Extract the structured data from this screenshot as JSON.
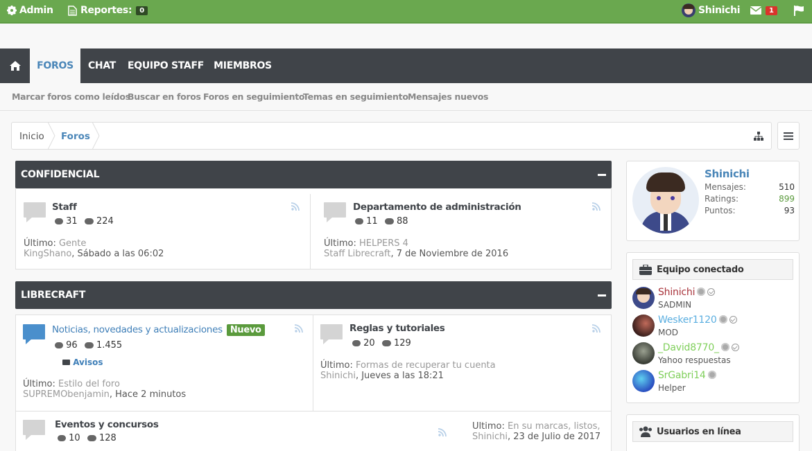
{
  "topbar": {
    "admin_label": "Admin",
    "reports_label": "Reportes:",
    "reports_count": "0",
    "user_name": "Shinichi",
    "messages_count": "1"
  },
  "nav": {
    "tabs": [
      {
        "label": "FOROS"
      },
      {
        "label": "CHAT"
      },
      {
        "label": "EQUIPO STAFF"
      },
      {
        "label": "MIEMBROS"
      }
    ],
    "subnav": [
      {
        "label": "Marcar foros como leídos"
      },
      {
        "label": "Buscar en foros"
      },
      {
        "label": "Foros en seguimiento"
      },
      {
        "label": "Temas en seguimiento"
      },
      {
        "label": "Mensajes nuevos"
      }
    ]
  },
  "breadcrumb": {
    "home": "Inicio",
    "current": "Foros"
  },
  "categories": [
    {
      "title": "CONFIDENCIAL",
      "forums": [
        {
          "name": "Staff",
          "threads": "31",
          "posts": "224",
          "last_label": "Último:",
          "last_title": "Gente",
          "last_user": "KingShano",
          "last_date": ", Sábado a las 06:02"
        },
        {
          "name": "Departamento de administración",
          "threads": "11",
          "posts": "88",
          "last_label": "Último:",
          "last_title": "HELPERS 4",
          "last_user": "Staff Librecraft",
          "last_date": ", 7 de Noviembre de 2016"
        }
      ]
    },
    {
      "title": "LIBRECRAFT",
      "forums": [
        {
          "name": "Noticias, novedades y actualizaciones",
          "badge": "Nuevo",
          "threads": "96",
          "posts": "1.455",
          "subforum": "Avisos",
          "last_label": "Último:",
          "last_title": "Estilo del foro",
          "last_user": "SUPREMObenjamin",
          "last_date": ", Hace 2 minutos"
        },
        {
          "name": "Reglas y tutoriales",
          "threads": "20",
          "posts": "129",
          "last_label": "Último:",
          "last_title": "Formas de recuperar tu cuenta",
          "last_user": "Shinichi",
          "last_date": ", Jueves a las 18:21"
        },
        {
          "name": "Eventos y concursos",
          "threads": "10",
          "posts": "128",
          "last_label": "Último:",
          "last_title": "En su marcas, listos, ¡...",
          "last_user": "Shinichi",
          "last_date": ", 23 de Julio de 2017"
        }
      ]
    }
  ],
  "profile": {
    "name": "Shinichi",
    "rows": [
      {
        "label": "Mensajes:",
        "value": "510"
      },
      {
        "label": "Ratings:",
        "value": "899"
      },
      {
        "label": "Puntos:",
        "value": "93"
      }
    ]
  },
  "staff_online": {
    "title": "Equipo conectado",
    "members": [
      {
        "name": "Shinichi",
        "role": "SADMIN",
        "color": "#a8323a"
      },
      {
        "name": "Wesker1120",
        "role": "MOD",
        "color": "#5aaee0"
      },
      {
        "name": "_David8770_",
        "role": "Yahoo respuestas",
        "color": "#7fcf5a"
      },
      {
        "name": "SrGabri14",
        "role": "Helper",
        "color": "#7fcf5a"
      }
    ]
  },
  "online_users": {
    "title": "Usuarios en línea"
  },
  "colors": {
    "topbar": "#6aa84f",
    "nav": "#404449",
    "accent": "#4a86b8",
    "badge_new": "#5a9a3c",
    "ratings_positive": "#5a9a3c"
  }
}
